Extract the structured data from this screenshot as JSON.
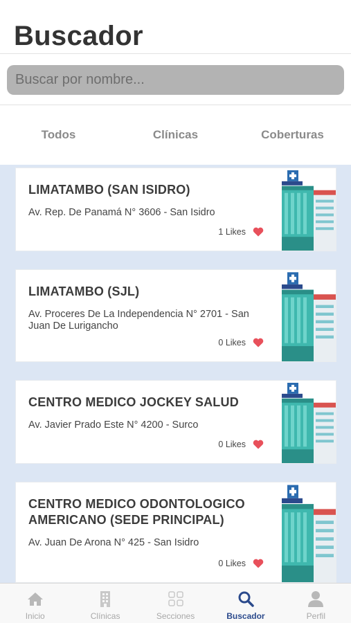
{
  "header": {
    "title": "Buscador"
  },
  "search": {
    "placeholder": "Buscar por nombre..."
  },
  "tabs": [
    {
      "label": "Todos"
    },
    {
      "label": "Clínicas"
    },
    {
      "label": "Coberturas"
    }
  ],
  "clinics": [
    {
      "name": "LIMATAMBO (SAN ISIDRO)",
      "address": "Av. Rep. De Panamá N° 3606 - San Isidro",
      "likes": "1 Likes"
    },
    {
      "name": "LIMATAMBO (SJL)",
      "address": "Av. Proceres De La Independencia N° 2701 - San Juan De Lurigancho",
      "likes": "0 Likes"
    },
    {
      "name": "CENTRO MEDICO JOCKEY SALUD",
      "address": "Av. Javier Prado Este N° 4200 - Surco",
      "likes": "0 Likes"
    },
    {
      "name": "CENTRO MEDICO ODONTOLOGICO AMERICANO (SEDE PRINCIPAL)",
      "address": "Av. Juan De Arona N° 425 - San Isidro",
      "likes": "0 Likes"
    }
  ],
  "nav": [
    {
      "label": "Inicio",
      "icon": "home-icon"
    },
    {
      "label": "Clínicas",
      "icon": "building-icon"
    },
    {
      "label": "Secciones",
      "icon": "grid-icon"
    },
    {
      "label": "Buscador",
      "icon": "search-icon",
      "active": true
    },
    {
      "label": "Perfil",
      "icon": "user-icon"
    }
  ],
  "colors": {
    "list_background": "#dce6f4",
    "heart": "#e8505b",
    "nav_active": "#2b4a8c",
    "nav_inactive": "#a8a8a8"
  }
}
